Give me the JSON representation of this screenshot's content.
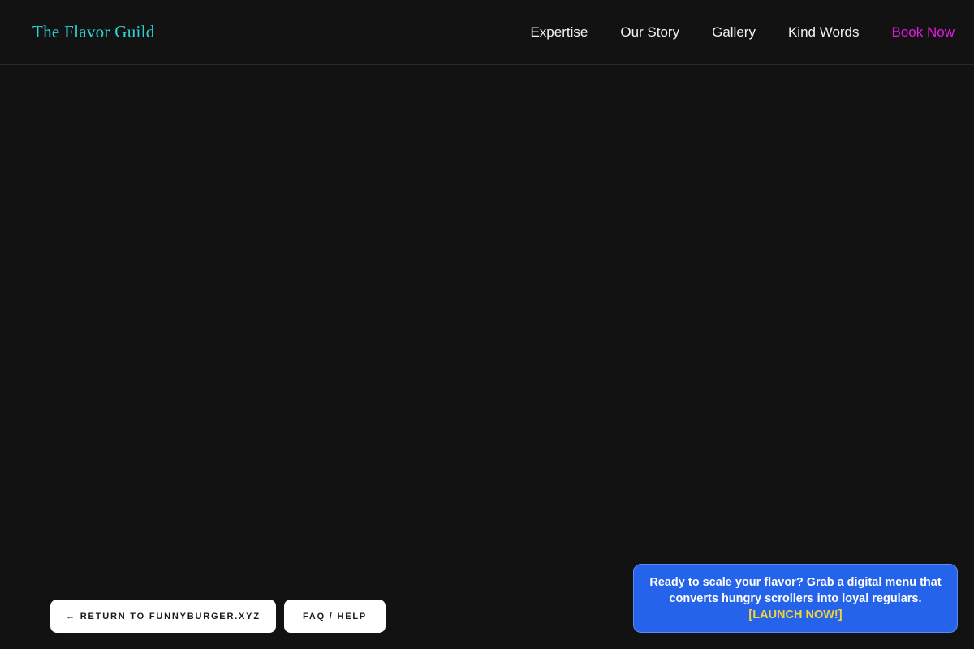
{
  "header": {
    "brand": "The Flavor Guild",
    "nav": [
      {
        "label": "Expertise"
      },
      {
        "label": "Our Story"
      },
      {
        "label": "Gallery"
      },
      {
        "label": "Kind Words"
      },
      {
        "label": "Book Now"
      }
    ]
  },
  "footer_buttons": {
    "return_label": "← RETURN TO FUNNYBURGER.XYZ",
    "faq_label": "FAQ / HELP"
  },
  "promo": {
    "text": "Ready to scale your flavor? Grab a digital menu that converts hungry scrollers into loyal regulars.",
    "cta": "[LAUNCH NOW!]"
  },
  "colors": {
    "background": "#121212",
    "brand": "#2ed3d3",
    "nav_cta": "#e01be0",
    "promo_bg": "#2563eb",
    "promo_cta": "#f5d33a"
  }
}
